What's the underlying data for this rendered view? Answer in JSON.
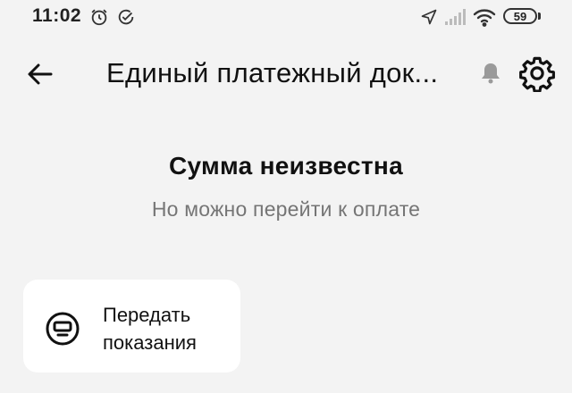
{
  "status_bar": {
    "time": "11:02",
    "battery": "59",
    "icons": [
      "alarm-icon",
      "check-circle-icon",
      "location-arrow-icon",
      "signal-icon",
      "wifi-icon",
      "battery-icon"
    ]
  },
  "header": {
    "title": "Единый платежный док...",
    "back_icon": "arrow-left-icon",
    "bell_icon": "bell-icon",
    "settings_icon": "gear-icon"
  },
  "main": {
    "amount_title": "Сумма неизвестна",
    "amount_subtitle": "Но можно перейти к оплате"
  },
  "action_card": {
    "label": "Передать\nпоказания",
    "icon": "meter-icon"
  },
  "colors": {
    "background": "#f3f3f3",
    "card": "#ffffff",
    "text": "#111111",
    "muted_text": "#757575"
  }
}
